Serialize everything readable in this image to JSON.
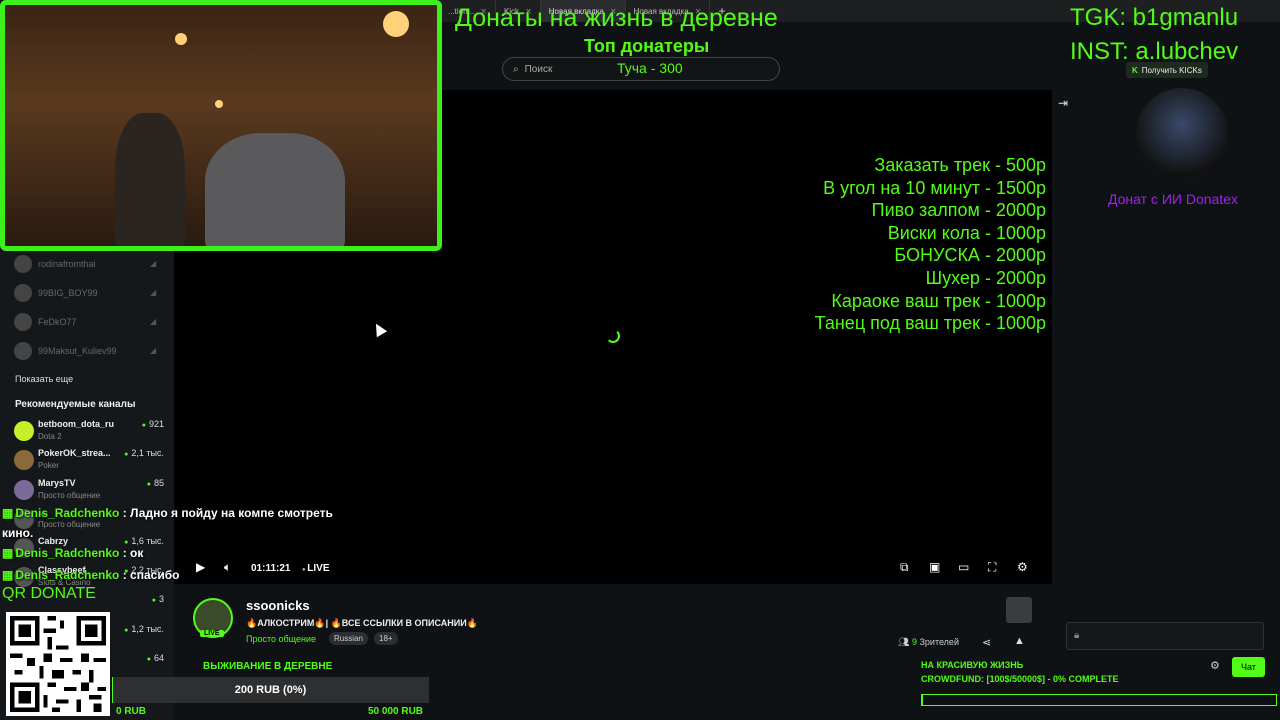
{
  "browser": {
    "tabs": [
      {
        "label": "...tion...",
        "active": false
      },
      {
        "label": "Kick",
        "active": false
      },
      {
        "label": "Новая вкладка",
        "active": true
      },
      {
        "label": "Новая вкладка",
        "active": false
      }
    ],
    "new_tab": "+"
  },
  "header": {
    "search_placeholder": "Поиск",
    "kicks_button": "Получить KICKs"
  },
  "sidebar": {
    "followed": [
      {
        "name": "rodinafromthai"
      },
      {
        "name": "99BIG_BOY99"
      },
      {
        "name": "FeDkO77"
      },
      {
        "name": "99Maksut_Kuliev99"
      }
    ],
    "show_more": "Показать еще",
    "recommended_title": "Рекомендуемые каналы",
    "recommended": [
      {
        "name": "betboom_dota_ru",
        "category": "Dota 2",
        "viewers": "921",
        "color": "#c8f02a"
      },
      {
        "name": "PokerOK_strea...",
        "category": "Poker",
        "viewers": "2,1 тыс.",
        "color": "#8a6a3a"
      },
      {
        "name": "MarysTV",
        "category": "Просто общение",
        "viewers": "85",
        "color": "#7a6a9a"
      },
      {
        "name": "...",
        "category": "Просто общение",
        "viewers": "",
        "color": "#555555"
      },
      {
        "name": "Cabrzy",
        "category": "",
        "viewers": "1,6 тыс.",
        "color": "#555555"
      },
      {
        "name": "Classybeef",
        "category": "Slots & Casino",
        "viewers": "2,2 тыс.",
        "color": "#555555"
      },
      {
        "name": "...",
        "category": "",
        "viewers": "3",
        "color": "#555555"
      },
      {
        "name": "...",
        "category": "",
        "viewers": "1,2 тыс.",
        "color": "#555555"
      },
      {
        "name": "...",
        "category": "",
        "viewers": "64",
        "color": "#555555"
      }
    ]
  },
  "player": {
    "time": "01:11:21",
    "live_label": "LIVE"
  },
  "price_list": [
    "Заказать трек - 500р",
    "В угол на 10 минут - 1500р",
    "Пиво залпом - 2000р",
    "Виски кола - 1000р",
    "БОНУСКА - 2000р",
    "Шухер - 2000р",
    "Караоке ваш трек - 1000р",
    "Танец под ваш трек - 1000р"
  ],
  "channel": {
    "name": "ssoonicks",
    "live_badge": "LIVE",
    "title": "🔥АЛКОСТРИМ🔥| 🔥ВСЕ ССЫЛКИ В ОПИСАНИИ🔥",
    "category": "Просто общение",
    "tags": [
      "Russian",
      "18+"
    ],
    "viewers_label": "Зрителей",
    "viewers_count": "9"
  },
  "chat": {
    "donatex_label": "Донат с ИИ Donatex",
    "send_button": "Чат"
  },
  "overlay": {
    "title": "Донаты на жизнь в деревне",
    "top_donors_title": "Топ донатеры",
    "top_donor": "Туча - 300",
    "tgk": "TGK: b1gmanlu",
    "inst": "INST: a.lubchev",
    "chat_messages": [
      {
        "user": "Denis_Radchenko",
        "text": " : Ладно я пойду на компе смотреть"
      },
      {
        "user": "",
        "text": "кино."
      },
      {
        "user": "Denis_Radchenko",
        "text": " : ок"
      },
      {
        "user": "Denis_Radchenko",
        "text": " : спасибо"
      }
    ],
    "qr_label": "QR DONATE",
    "goal": {
      "label": "ВЫЖИВАНИЕ В ДЕРЕВНЕ",
      "progress_text": "200 RUB (0%)",
      "progress_fraction": 0.004,
      "min": "0 RUB",
      "max": "50 000 RUB"
    },
    "crowdfund": {
      "title": "НА КРАСИВУЮ ЖИЗНЬ",
      "status": "CROWDFUND: [100$/50000$] - 0% COMPLETE",
      "progress_fraction": 0.002
    }
  },
  "colors": {
    "accent": "#53fc18",
    "overlay_green": "#3cf01c",
    "donatex": "#a020f0"
  }
}
